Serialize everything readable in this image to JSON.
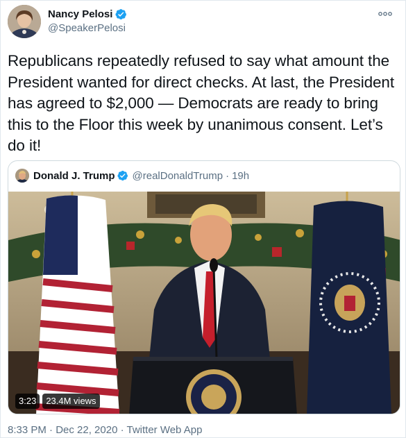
{
  "author": {
    "name": "Nancy Pelosi",
    "handle": "@SpeakerPelosi",
    "verified": true
  },
  "tweet": {
    "text": "Republicans repeatedly refused to say what amount the President wanted for direct checks. At last, the President has agreed to $2,000 — Democrats are ready to bring this to the Floor this week by unanimous consent. Let’s do it!"
  },
  "quoted_tweet": {
    "name": "Donald J. Trump",
    "handle": "@realDonaldTrump",
    "separator": "·",
    "time": "19h",
    "verified": true,
    "video": {
      "duration": "3:23",
      "views": "23.4M views"
    }
  },
  "meta": {
    "timestamp": "8:33 PM · Dec 22, 2020 · Twitter Web App"
  },
  "icons": {
    "verified": "verified-badge-icon",
    "more": "more-options-icon"
  },
  "colors": {
    "text_primary": "#0f1419",
    "text_secondary": "#5b7083",
    "verified_blue": "#1da1f2",
    "border": "#cfd9de"
  }
}
